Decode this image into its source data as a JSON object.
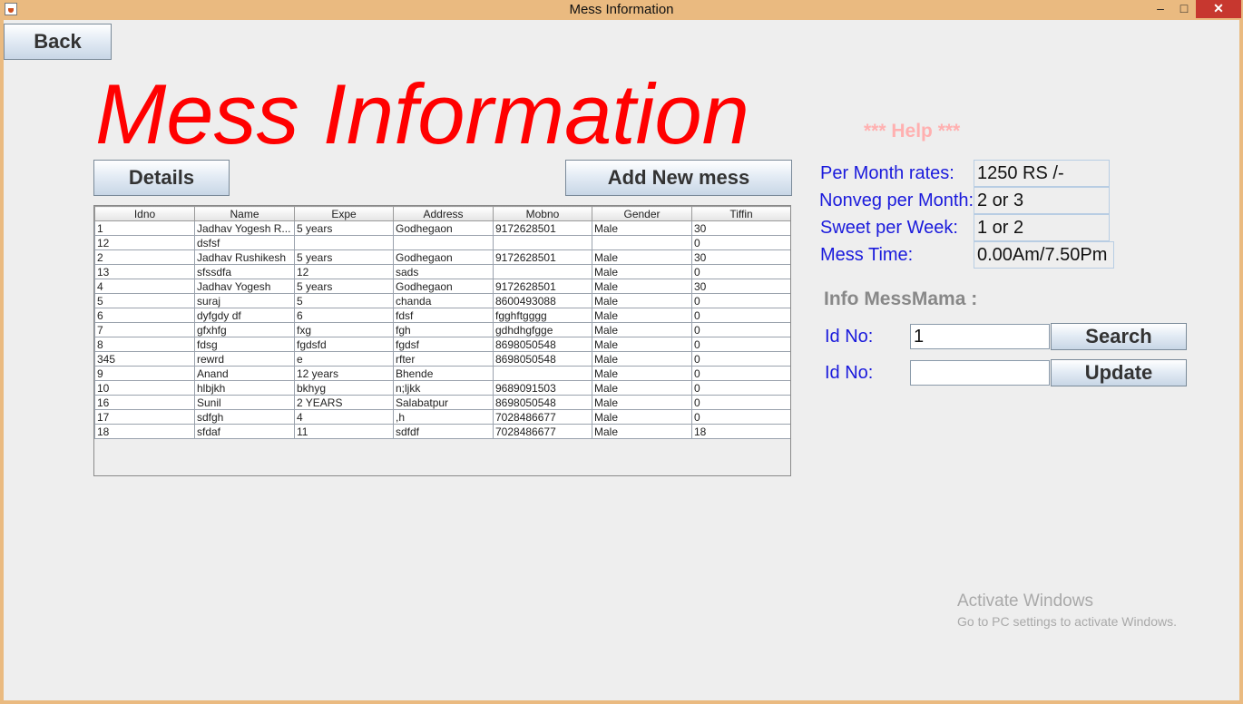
{
  "window": {
    "title": "Mess Information",
    "minimize_symbol": "–",
    "maximize_symbol": "□",
    "close_symbol": "✕",
    "app_icon": "java-cup-icon"
  },
  "toolbar": {
    "back_label": "Back"
  },
  "page": {
    "heading": "Mess Information",
    "help_text": "*** Help ***"
  },
  "actions": {
    "details_label": "Details",
    "add_new_mess_label": "Add New mess"
  },
  "table": {
    "columns": [
      "Idno",
      "Name",
      "Expe",
      "Address",
      "Mobno",
      "Gender",
      "Tiffin"
    ],
    "rows": [
      [
        "1",
        "Jadhav Yogesh R...",
        " 5 years",
        "Godhegaon",
        "9172628501",
        "Male",
        "30"
      ],
      [
        "12",
        "dsfsf",
        "",
        "",
        "",
        "",
        "0"
      ],
      [
        "2",
        "Jadhav Rushikesh",
        " 5 years",
        "Godhegaon",
        "9172628501",
        "Male",
        "30"
      ],
      [
        "13",
        "sfssdfa",
        "12",
        "sads",
        "",
        "Male",
        "0"
      ],
      [
        "4",
        "Jadhav Yogesh",
        " 5 years",
        "Godhegaon",
        "9172628501",
        "Male",
        "30"
      ],
      [
        "5",
        "suraj",
        "5",
        "chanda",
        "8600493088",
        "Male",
        "0"
      ],
      [
        "6",
        "dyfgdy df",
        "6",
        "fdsf",
        "fgghftgggg",
        "Male",
        "0"
      ],
      [
        "7",
        "gfxhfg",
        "fxg",
        "fgh",
        "gdhdhgfgge",
        "Male",
        "0"
      ],
      [
        "8",
        "fdsg",
        "fgdsfd",
        "fgdsf",
        "8698050548",
        "Male",
        "0"
      ],
      [
        "345",
        "rewrd",
        "e",
        "rfter",
        "8698050548",
        "Male",
        "0"
      ],
      [
        "9",
        "Anand",
        "12 years",
        "Bhende",
        "",
        "Male",
        "0"
      ],
      [
        "10",
        "hlbjkh",
        "bkhyg",
        "n;ljkk",
        "9689091503",
        "Male",
        "0"
      ],
      [
        "16",
        "Sunil",
        "2 YEARS",
        "Salabatpur",
        "8698050548",
        "Male",
        "0"
      ],
      [
        "17",
        "sdfgh",
        "4",
        ",h",
        "7028486677",
        "Male",
        "0"
      ],
      [
        "18",
        "sfdaf",
        "11",
        "sdfdf",
        "7028486677",
        "Male",
        "18"
      ]
    ]
  },
  "help_info": {
    "rates_label": "Per Month rates:",
    "rates_value": "1250 RS /-",
    "nonveg_label": "Nonveg per Month:",
    "nonveg_value": "2 or 3",
    "sweet_label": "Sweet per Week:",
    "sweet_value": "1 or 2",
    "time_label": "Mess Time:",
    "time_value": "0.00Am/7.50Pm"
  },
  "messmama": {
    "title": "Info MessMama :",
    "search_id_label": "Id No:",
    "search_id_value": "1",
    "search_label": "Search",
    "update_id_label": "Id No:",
    "update_id_value": "",
    "update_label": "Update"
  },
  "watermark": {
    "line1": "Activate Windows",
    "line2": "Go to PC settings to activate Windows."
  }
}
